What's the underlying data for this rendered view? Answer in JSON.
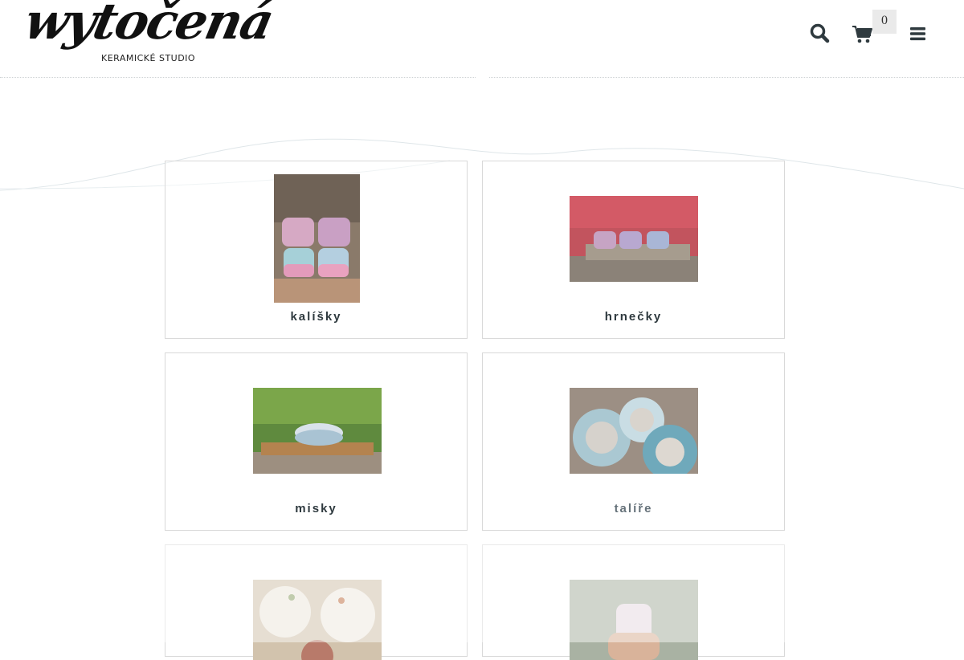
{
  "header": {
    "logo_main": "wytočená",
    "logo_sub": "KERAMICKÉ STUDIO",
    "cart_count": "0"
  },
  "categories": [
    {
      "label": "kalíšky"
    },
    {
      "label": "hrnečky"
    },
    {
      "label": "misky"
    },
    {
      "label": "talíře"
    },
    {
      "label": ""
    },
    {
      "label": ""
    }
  ],
  "colors": {
    "text": "#2f3a3f",
    "border": "#d9d9d9",
    "icon": "#2f3a3f"
  }
}
